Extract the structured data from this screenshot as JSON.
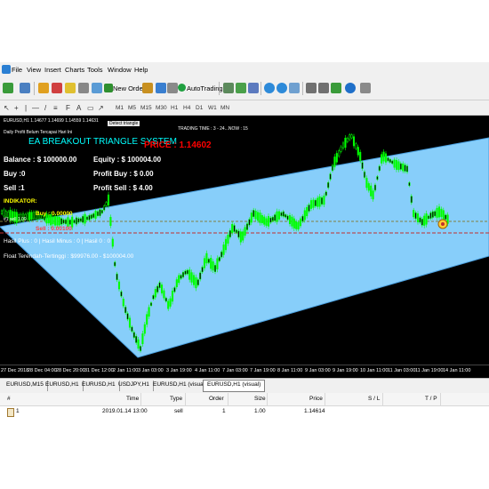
{
  "menu": {
    "items": [
      "File",
      "View",
      "Insert",
      "Charts",
      "Tools",
      "Window",
      "Help"
    ]
  },
  "toolbar": {
    "new_order": "New Order",
    "auto_trading": "AutoTrading"
  },
  "toolbar2": {
    "timeframes": [
      "M1",
      "M5",
      "M15",
      "M30",
      "H1",
      "H4",
      "D1",
      "W1",
      "MN"
    ]
  },
  "chart": {
    "symbol_info": "EURUSD,H1  1.14677 1.14699 1.14559 1.14631",
    "chart_button": "Detect triangle",
    "trading_time": "TRADING TIME : 3 - 24...NOW : 15",
    "profit_note": "Daily Profit Belum Tercapai Hari Ini",
    "ea_title": "EA BREAKOUT TRIANGLE SYSTEM",
    "price_label": "PRICE : 1.14602",
    "balance": "Balance : $ 100000.00",
    "equity": "Equity : $ 100004.00",
    "buy": "Buy :0",
    "sell": "Sell :1",
    "profit_buy": "Profit Buy  : $ 0.00",
    "profit_sell": "Profit Sell  : $ 4.00",
    "indikator": "INDIKATOR:",
    "buy_line": "Buy : 0.00000",
    "buy_line_tag": "#1 sell 1.00",
    "sell_line": "Sell : 0.00100",
    "hasil": "Hasil Plus : 0 | Hasil Minus : 0 | Hasil 0 : 0",
    "float": "Float Terendah-Tertinggi : $99976.00 - $100004.00",
    "x_ticks": [
      "27 Dec 2018",
      "28 Dec 04:00",
      "28 Dec 20:00",
      "31 Dec 12:00",
      "2 Jan 11:00",
      "3 Jan 03:00",
      "3 Jan 19:00",
      "4 Jan 11:00",
      "7 Jan 03:00",
      "7 Jan 19:00",
      "8 Jan 11:00",
      "9 Jan 03:00",
      "9 Jan 19:00",
      "10 Jan 11:00",
      "11 Jan 03:00",
      "11 Jan 19:00",
      "14 Jan 11:00"
    ],
    "colors": {
      "background": "#000000",
      "triangle": "#87cefa",
      "candles": "#00ff00",
      "title": "#00ffff",
      "price": "#ff0000",
      "info": "#ffffff",
      "indikator": "#ffff00"
    }
  },
  "tabs": [
    "EURUSD,M15",
    "EURUSD,H1",
    "EURUSD,H1",
    "USDJPY,H1",
    "EURUSD,H1 (visual)",
    "EURUSD,H1 (visual)"
  ],
  "active_tab_index": 5,
  "table": {
    "headers": [
      "#",
      "Time",
      "Type",
      "Order",
      "Size",
      "Price",
      "S / L",
      "T / P"
    ],
    "rows": [
      {
        "id": "1",
        "time": "2019.01.14 13:00",
        "type": "sell",
        "order": "1",
        "size": "1.00",
        "price": "1.14614",
        "sl": "",
        "tp": ""
      }
    ]
  }
}
